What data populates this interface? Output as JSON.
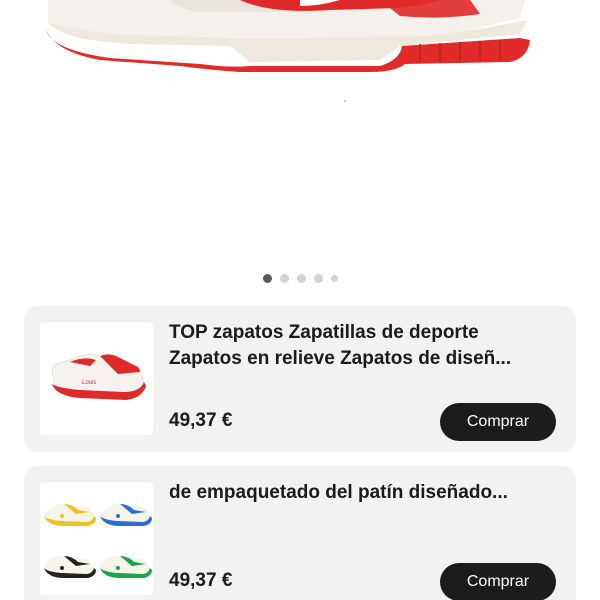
{
  "hero": {
    "image": "red-white-sneaker-photo"
  },
  "carousel": {
    "total": 5,
    "active_index": 0
  },
  "products": [
    {
      "title_lines": [
        "TOP zapatos Zapatillas de deporte",
        "Zapatos en relieve Zapatos de diseñ..."
      ],
      "price": "49,37 €",
      "buy_label": "Comprar",
      "thumb": "red-white-sneaker-thumb"
    },
    {
      "title_lines": [
        "de empaquetado del patín diseñado..."
      ],
      "price": "49,37 €",
      "buy_label": "Comprar",
      "thumb": "four-color-sneakers-thumb"
    }
  ],
  "colors": {
    "accent_red": "#e02a2a",
    "button_bg": "#1c1c1c",
    "card_bg": "#f2f2f2"
  }
}
